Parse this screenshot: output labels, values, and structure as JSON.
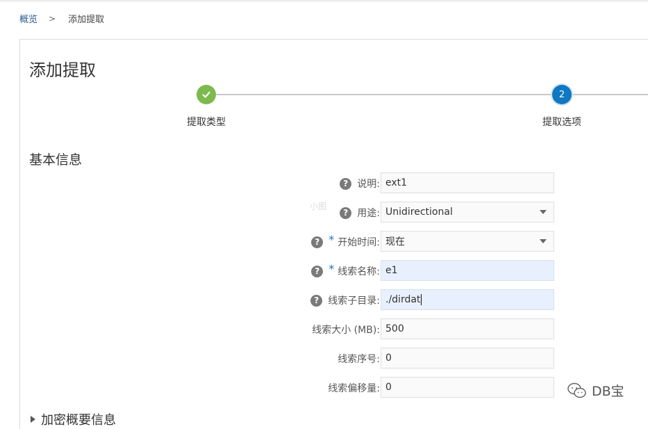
{
  "breadcrumb": {
    "root": "概览",
    "separator": ">",
    "current": "添加提取"
  },
  "page": {
    "title": "添加提取"
  },
  "wizard": {
    "steps": [
      {
        "label": "提取类型",
        "state": "done",
        "marker": "✓"
      },
      {
        "label": "提取选项",
        "state": "active",
        "marker": "2"
      }
    ]
  },
  "section": {
    "title": "基本信息"
  },
  "form": {
    "description": {
      "label": "说明:",
      "value": "ext1"
    },
    "usage": {
      "label": "用途:",
      "value": "Unidirectional"
    },
    "start_time": {
      "label": "开始时间:",
      "value": "现在",
      "required_mark": "*"
    },
    "trail_name": {
      "label": "线索名称:",
      "value": "e1",
      "required_mark": "*"
    },
    "trail_subdir": {
      "label": "线索子目录:",
      "value": "./dirdat"
    },
    "trail_size": {
      "label": "线索大小 (MB):",
      "value": "500"
    },
    "trail_seq": {
      "label": "线索序号:",
      "value": "0"
    },
    "trail_offset": {
      "label": "线索偏移量:",
      "value": "0"
    }
  },
  "collapsed_section": {
    "title": "加密概要信息"
  },
  "help_icon_text": "?",
  "watermark": {
    "mid": "小图",
    "corner": "DB宝"
  },
  "colors": {
    "done": "#7cb94e",
    "active": "#0f78c0",
    "link": "#2a5d8c",
    "filled_field": "#e8f0fe"
  }
}
